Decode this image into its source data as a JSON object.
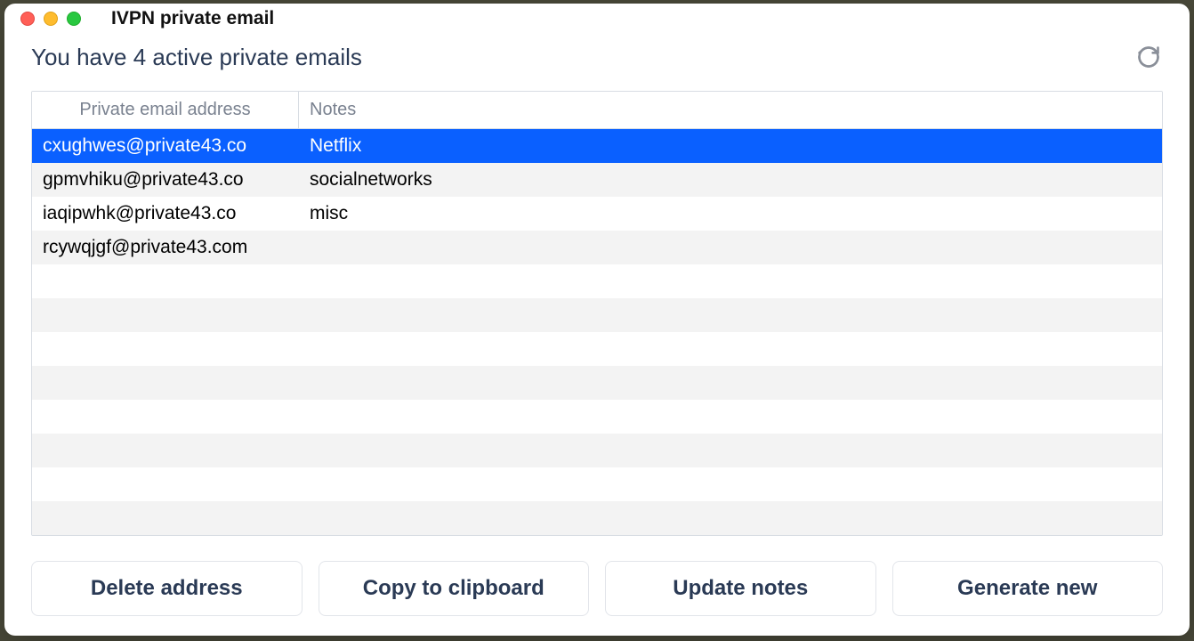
{
  "window": {
    "title": "IVPN private email"
  },
  "header": {
    "status": "You have 4 active private emails"
  },
  "table": {
    "columns": {
      "email": "Private email address",
      "notes": "Notes"
    },
    "rows": [
      {
        "email": "cxughwes@private43.co",
        "notes": "Netflix",
        "selected": true
      },
      {
        "email": "gpmvhiku@private43.co",
        "notes": "socialnetworks",
        "selected": false
      },
      {
        "email": "iaqipwhk@private43.co",
        "notes": "misc",
        "selected": false
      },
      {
        "email": "rcywqjgf@private43.com",
        "notes": "",
        "selected": false
      },
      {
        "email": "",
        "notes": "",
        "selected": false
      },
      {
        "email": "",
        "notes": "",
        "selected": false
      },
      {
        "email": "",
        "notes": "",
        "selected": false
      },
      {
        "email": "",
        "notes": "",
        "selected": false
      },
      {
        "email": "",
        "notes": "",
        "selected": false
      },
      {
        "email": "",
        "notes": "",
        "selected": false
      },
      {
        "email": "",
        "notes": "",
        "selected": false
      },
      {
        "email": "",
        "notes": "",
        "selected": false
      }
    ]
  },
  "buttons": {
    "delete": "Delete address",
    "copy": "Copy to clipboard",
    "update": "Update notes",
    "generate": "Generate new"
  }
}
